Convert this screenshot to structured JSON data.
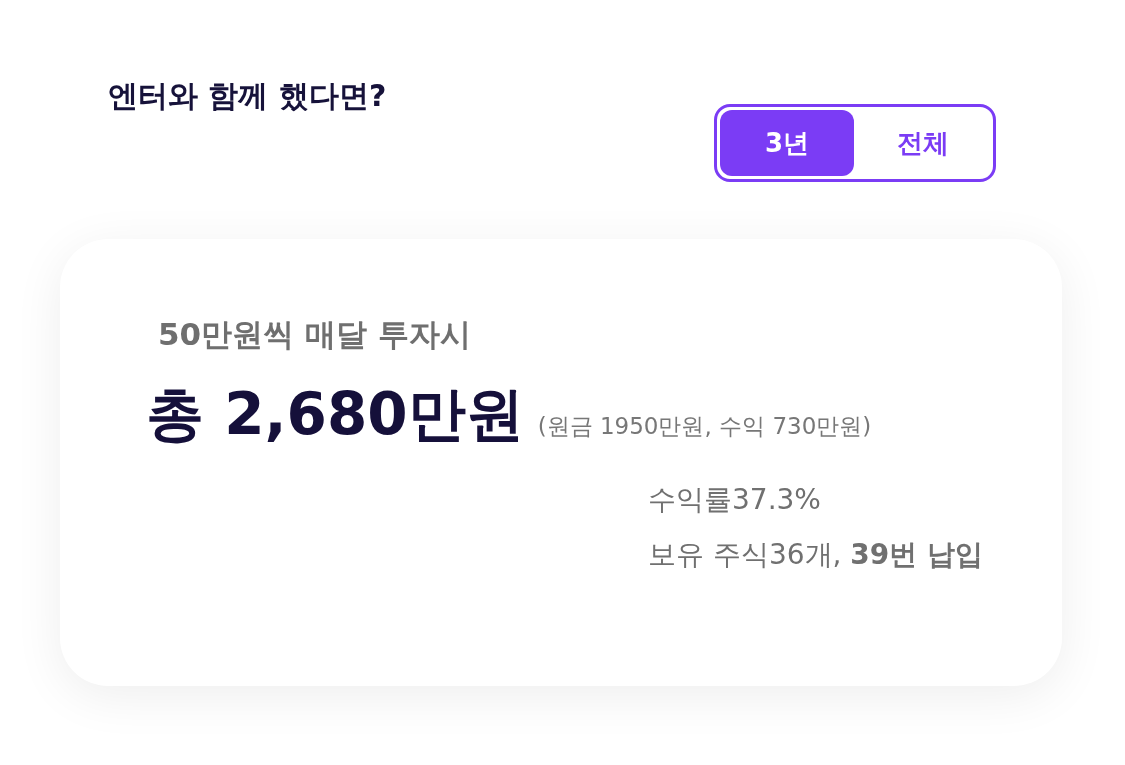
{
  "title": "엔터와 함께 했다면?",
  "period_tabs": [
    {
      "label": "3년",
      "selected": true
    },
    {
      "label": "전체",
      "selected": false
    }
  ],
  "card": {
    "subtitle": "50만원씩 매달 투자시",
    "total": "총 2,680만원",
    "breakdown": "(원금 1950만원, 수익 730만원)",
    "stats": [
      "수익률37.3%",
      "보유 주식36개, **39번 납입**"
    ]
  }
}
